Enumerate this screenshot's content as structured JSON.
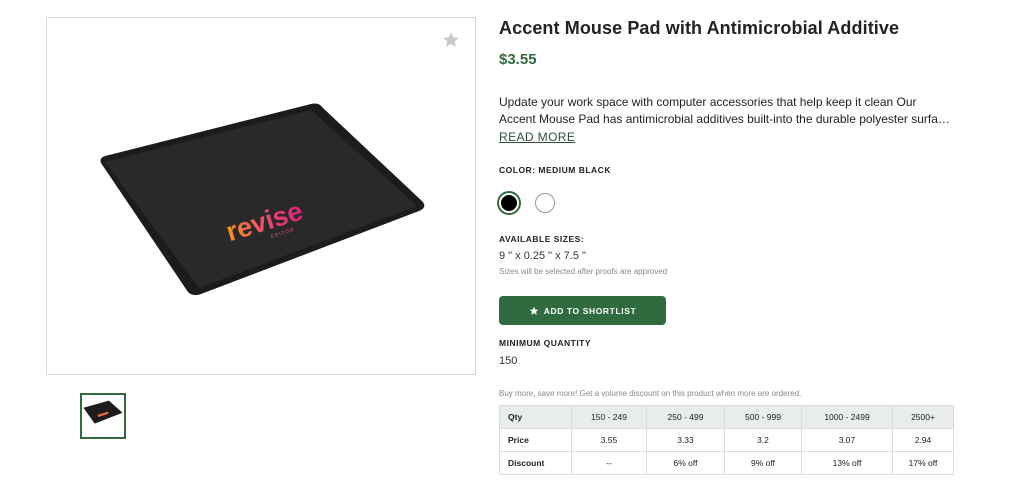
{
  "product": {
    "title": "Accent Mouse Pad with Antimicrobial Additive",
    "price": "$3.55",
    "description_line1": "Update your work space with computer accessories that help keep it clean Our",
    "description_line2": "Accent Mouse Pad has antimicrobial additives built-into the durable polyester surfa…",
    "read_more": "READ MORE",
    "imprint_text": "revise",
    "imprint_subtext": "EDITOR"
  },
  "color": {
    "label": "COLOR: MEDIUM BLACK",
    "options": [
      {
        "name": "Medium Black",
        "hex": "#000000",
        "selected": true
      },
      {
        "name": "White",
        "hex": "#ffffff",
        "selected": false
      }
    ]
  },
  "sizes": {
    "label": "AVAILABLE SIZES:",
    "value": "9 \" x 0.25 \" x 7.5 \"",
    "note": "Sizes will be selected after proofs are approved"
  },
  "shortlist": {
    "label": "ADD TO SHORTLIST",
    "icon": "star-icon"
  },
  "minimum": {
    "label": "MINIMUM QUANTITY",
    "value": "150"
  },
  "volume_note": "Buy more, save more! Get a volume discount on this product when more are ordered.",
  "pricing_table": {
    "headers": [
      "Qty",
      "150 - 249",
      "250 - 499",
      "500 - 999",
      "1000 - 2499",
      "2500+"
    ],
    "price_row": [
      "Price",
      "3.55",
      "3.33",
      "3.2",
      "3.07",
      "2.94"
    ],
    "discount_row": [
      "Discount",
      "--",
      "6% off",
      "9% off",
      "13% off",
      "17% off"
    ]
  },
  "colors": {
    "accent": "#2f6b3f",
    "table_header_bg": "#e8ede9"
  }
}
